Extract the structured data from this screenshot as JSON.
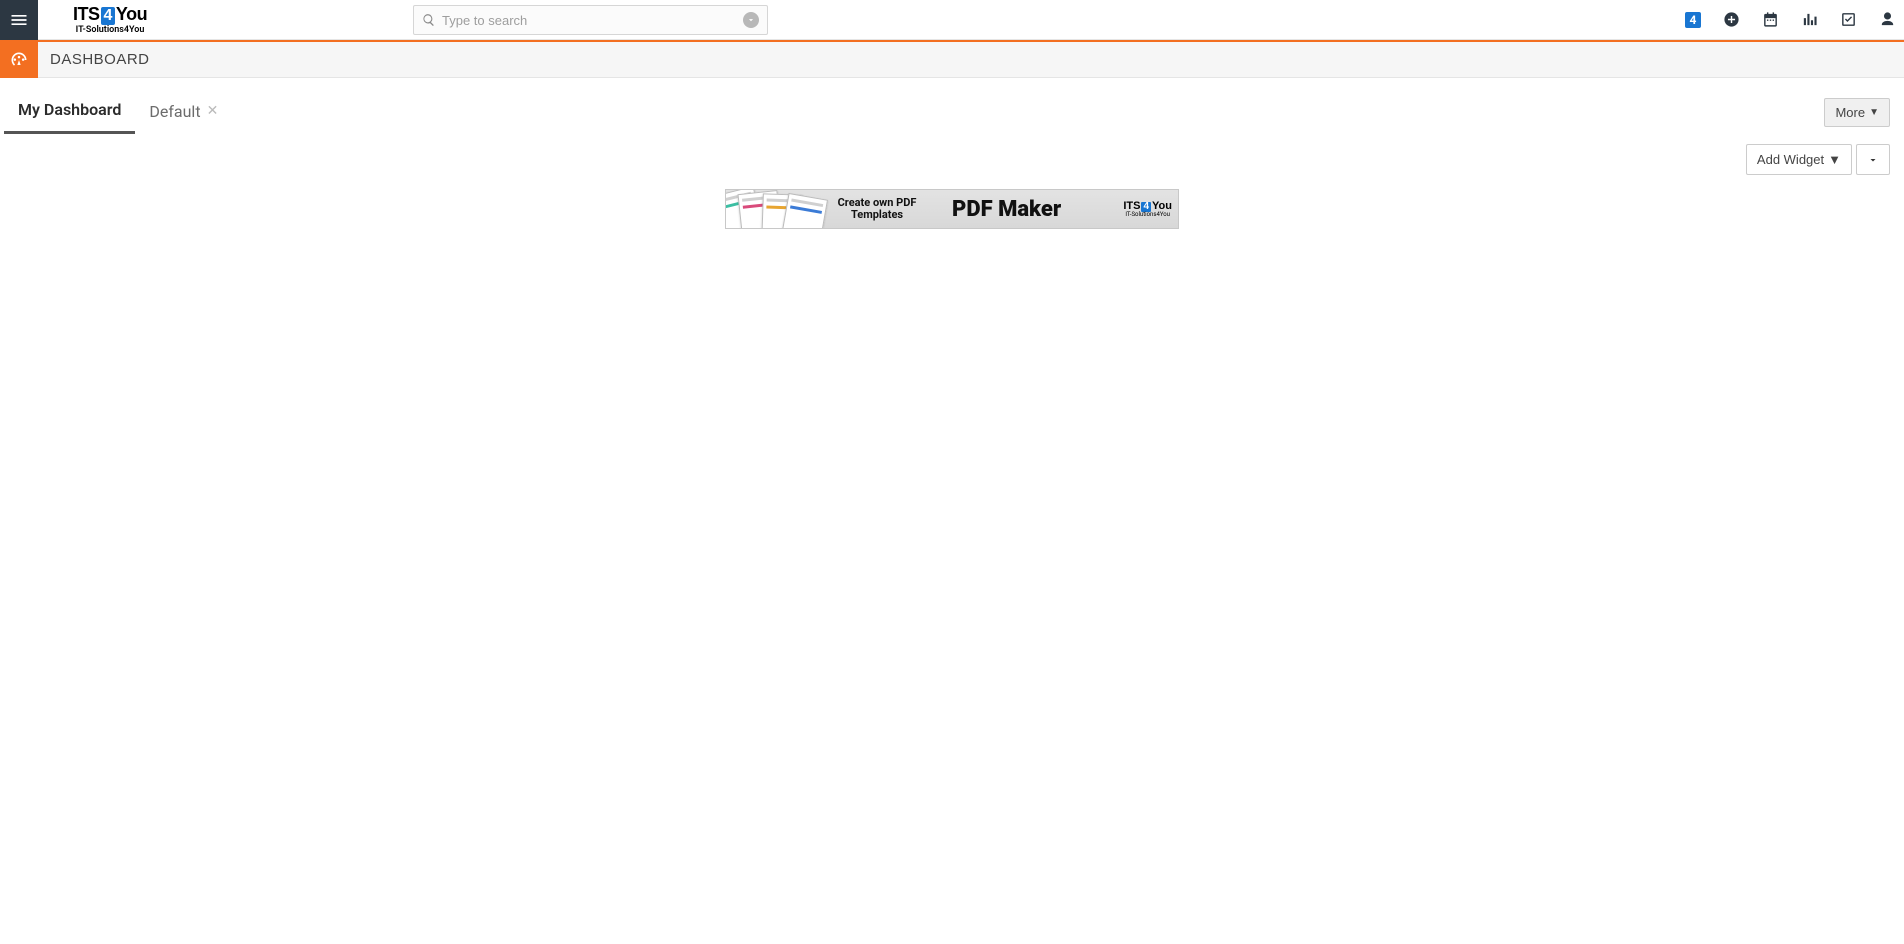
{
  "logo": {
    "prefix": "ITS",
    "box": "4",
    "suffix": "You",
    "tagline": "IT-Solutions4You"
  },
  "search": {
    "placeholder": "Type to search"
  },
  "topicons": {
    "its4_badge": "4"
  },
  "modulebar": {
    "title": "DASHBOARD"
  },
  "tabs": {
    "items": [
      {
        "label": "My Dashboard",
        "active": true,
        "closable": false
      },
      {
        "label": "Default",
        "active": false,
        "closable": true
      }
    ],
    "more_label": "More"
  },
  "widgetrow": {
    "add_widget_label": "Add Widget"
  },
  "banner": {
    "line1": "Create own PDF Templates",
    "line2": "PDF Maker",
    "logo_prefix": "ITS",
    "logo_box": "4",
    "logo_suffix": "You",
    "logo_tagline": "IT-Solutions4You"
  }
}
